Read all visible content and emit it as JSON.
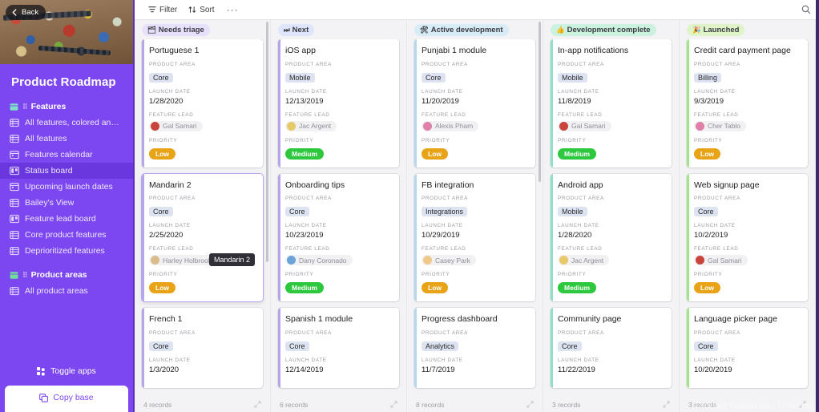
{
  "sidebar": {
    "back_label": "Back",
    "base_title": "Product Roadmap",
    "groups": [
      {
        "name": "Features",
        "icon": "table-icon",
        "items": [
          {
            "label": "All features, colored and sorted b...",
            "icon": "grid-view-icon",
            "active": false
          },
          {
            "label": "All features",
            "icon": "grid-view-icon",
            "active": false
          },
          {
            "label": "Features calendar",
            "icon": "calendar-view-icon",
            "active": false
          },
          {
            "label": "Status board",
            "icon": "kanban-view-icon",
            "active": true
          },
          {
            "label": "Upcoming launch dates",
            "icon": "calendar-view-icon",
            "active": false
          },
          {
            "label": "Bailey's View",
            "icon": "grid-view-icon",
            "active": false
          },
          {
            "label": "Feature lead board",
            "icon": "kanban-view-icon",
            "active": false
          },
          {
            "label": "Core product features",
            "icon": "grid-view-icon",
            "active": false
          },
          {
            "label": "Deprioritized features",
            "icon": "grid-view-icon",
            "active": false
          }
        ]
      },
      {
        "name": "Product areas",
        "icon": "table-icon",
        "items": [
          {
            "label": "All product areas",
            "icon": "grid-view-icon",
            "active": false
          }
        ]
      }
    ],
    "toggle_apps_label": "Toggle apps",
    "copy_base_label": "Copy base"
  },
  "toolbar": {
    "filter_label": "Filter",
    "sort_label": "Sort",
    "more_label": "···",
    "search_icon": "search-icon"
  },
  "watermark": "Product Roadmap - Universe",
  "tooltip": {
    "text": "Mandarin 2"
  },
  "field_labels": {
    "product_area": "PRODUCT AREA",
    "launch_date": "LAUNCH DATE",
    "feature_lead": "FEATURE LEAD",
    "priority": "PRIORITY"
  },
  "colors": {
    "sidebar_bg": "#7c47f0",
    "sidebar_active": "#6a36dd",
    "board_bg": "#f3f3f5",
    "priority_low": "#e8a317",
    "priority_medium": "#2ec83f",
    "accent_purple": "#b4a6e8",
    "accent_blue": "#b7d8ec",
    "accent_teal": "#8fe0c4",
    "accent_green": "#9fe88a",
    "tag_bg": "#dde3f0"
  },
  "board": {
    "stacks": [
      {
        "name": "Needs triage",
        "emoji": "🗂",
        "chip_bg": "#e7e0fb",
        "accent": "#b4a6e8",
        "footer": "4 records",
        "cards": [
          {
            "title": "Portuguese 1",
            "product_area": "Core",
            "launch_date": "1/28/2020",
            "feature_lead": "Gal Samari",
            "avatar": "#c9453b",
            "priority": "Low",
            "priority_color": "#e8a317",
            "hover": false
          },
          {
            "title": "Mandarin 2",
            "product_area": "Core",
            "launch_date": "2/25/2020",
            "feature_lead": "Harley Holbrook",
            "avatar": "#d9bc8a",
            "priority": "Low",
            "priority_color": "#e8a317",
            "hover": true
          },
          {
            "title": "French 1",
            "product_area": "Core",
            "launch_date": "1/3/2020",
            "feature_lead": "",
            "avatar": "",
            "priority": "",
            "priority_color": "",
            "hover": false
          }
        ]
      },
      {
        "name": "Next",
        "emoji": "⏭",
        "chip_bg": "#dfe6fb",
        "accent": "#b4a6e8",
        "footer": "6 records",
        "cards": [
          {
            "title": "iOS app",
            "product_area": "Mobile",
            "launch_date": "12/13/2019",
            "feature_lead": "Jac Argent",
            "avatar": "#e8c96a",
            "priority": "Medium",
            "priority_color": "#2ec83f",
            "hover": false
          },
          {
            "title": "Onboarding tips",
            "product_area": "Core",
            "launch_date": "10/23/2019",
            "feature_lead": "Dany Coronado",
            "avatar": "#6ba3d8",
            "priority": "Medium",
            "priority_color": "#2ec83f",
            "hover": false
          },
          {
            "title": "Spanish 1 module",
            "product_area": "Core",
            "launch_date": "12/14/2019",
            "feature_lead": "",
            "avatar": "",
            "priority": "",
            "priority_color": "",
            "hover": false
          }
        ]
      },
      {
        "name": "Active development",
        "emoji": "🛠",
        "chip_bg": "#d8ecf7",
        "accent": "#b7d8ec",
        "footer": "8 records",
        "cards": [
          {
            "title": "Punjabi 1 module",
            "product_area": "Core",
            "launch_date": "11/20/2019",
            "feature_lead": "Alexis Pham",
            "avatar": "#e07fa8",
            "priority": "Low",
            "priority_color": "#e8a317",
            "hover": false
          },
          {
            "title": "FB integration",
            "product_area": "Integrations",
            "launch_date": "10/29/2019",
            "feature_lead": "Casey Park",
            "avatar": "#f0c98a",
            "priority": "Low",
            "priority_color": "#e8a317",
            "hover": false
          },
          {
            "title": "Progress dashboard",
            "product_area": "Analytics",
            "launch_date": "11/7/2019",
            "feature_lead": "",
            "avatar": "",
            "priority": "",
            "priority_color": "",
            "hover": false
          }
        ]
      },
      {
        "name": "Development complete",
        "emoji": "👍",
        "chip_bg": "#caf2df",
        "accent": "#8fe0c4",
        "footer": "3 records",
        "cards": [
          {
            "title": "In-app notifications",
            "product_area": "Mobile",
            "launch_date": "11/8/2019",
            "feature_lead": "Gal Samari",
            "avatar": "#c9453b",
            "priority": "Medium",
            "priority_color": "#2ec83f",
            "hover": false
          },
          {
            "title": "Android app",
            "product_area": "Mobile",
            "launch_date": "1/28/2020",
            "feature_lead": "Jac Argent",
            "avatar": "#e8c96a",
            "priority": "Medium",
            "priority_color": "#2ec83f",
            "hover": false
          },
          {
            "title": "Community page",
            "product_area": "Core",
            "launch_date": "11/22/2019",
            "feature_lead": "",
            "avatar": "",
            "priority": "",
            "priority_color": "",
            "hover": false
          }
        ]
      },
      {
        "name": "Launched",
        "emoji": "🎉",
        "chip_bg": "#dff5c8",
        "accent": "#9fe88a",
        "footer": "3 records",
        "cards": [
          {
            "title": "Credit card payment page",
            "product_area": "Billing",
            "launch_date": "9/3/2019",
            "feature_lead": "Cher Tablo",
            "avatar": "#e07fa8",
            "priority": "Low",
            "priority_color": "#e8a317",
            "hover": false
          },
          {
            "title": "Web signup page",
            "product_area": "Core",
            "launch_date": "10/2/2019",
            "feature_lead": "Gal Samari",
            "avatar": "#c9453b",
            "priority": "Low",
            "priority_color": "#e8a317",
            "hover": false
          },
          {
            "title": "Language picker page",
            "product_area": "Core",
            "launch_date": "10/20/2019",
            "feature_lead": "",
            "avatar": "",
            "priority": "",
            "priority_color": "",
            "hover": false
          }
        ]
      }
    ]
  }
}
